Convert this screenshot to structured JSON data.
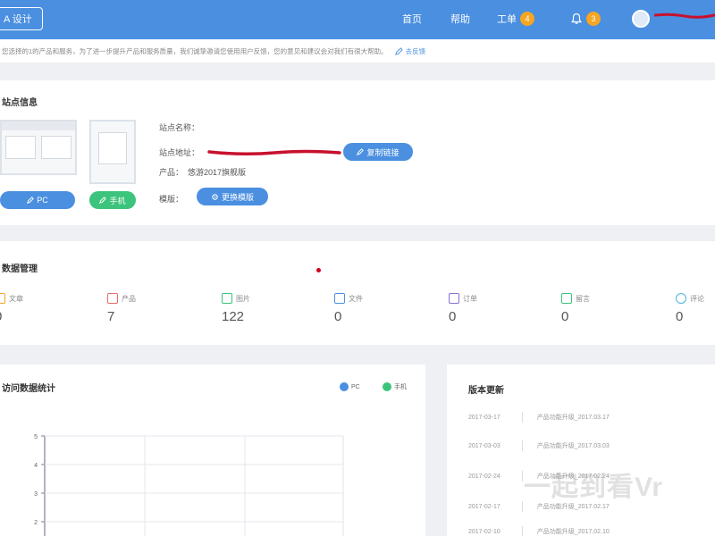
{
  "topbar": {
    "site_btn": "A 设计",
    "nav": [
      {
        "label": "首页"
      },
      {
        "label": "帮助"
      },
      {
        "label": "工单",
        "badge": "4"
      },
      {
        "label": "",
        "badge": "3"
      }
    ],
    "user_name": "",
    "accent": "#4a8fe0"
  },
  "notice": {
    "text": "您选择的1的产品和服务，为了进一步提升产品和服务质量，我们诚挚邀请您使用用户反馈，您的意见和建议会对我们有很大帮助。",
    "link": "去反馈"
  },
  "site": {
    "title": "站点信息",
    "pc_label": "PC",
    "mobile_label": "手机",
    "name_label": "站点名称：",
    "address_label": "站点地址：",
    "address_value": "",
    "copy_btn": "复制链接",
    "product_label": "产品：",
    "product_value": "悠游2017旗舰版",
    "template_label": "模版：",
    "template_btn": "更换模版"
  },
  "data": {
    "title": "数据管理",
    "stats": [
      {
        "label": "文章",
        "value": "0",
        "icon": "article-icon",
        "color": "#f5a623"
      },
      {
        "label": "产品",
        "value": "7",
        "icon": "product-icon",
        "color": "#e86a6a"
      },
      {
        "label": "图片",
        "value": "122",
        "icon": "image-icon",
        "color": "#3cc47c"
      },
      {
        "label": "文件",
        "value": "0",
        "icon": "folder-icon",
        "color": "#4a8fe0"
      },
      {
        "label": "订单",
        "value": "0",
        "icon": "order-icon",
        "color": "#8a6fd8"
      },
      {
        "label": "留言",
        "value": "0",
        "icon": "message-icon",
        "color": "#3cc47c"
      },
      {
        "label": "评论",
        "value": "0",
        "icon": "comment-icon",
        "color": "#4ab6e0"
      }
    ]
  },
  "chart": {
    "title": "访问数据统计",
    "legend": [
      {
        "name": "PC",
        "color": "#4a8fe0"
      },
      {
        "name": "手机",
        "color": "#3cc47c"
      }
    ]
  },
  "chart_data": {
    "type": "line",
    "title": "访问数据统计",
    "y_ticks": [
      2,
      3,
      4,
      5
    ],
    "ylim": [
      0,
      5
    ],
    "grid": true,
    "series": [
      {
        "name": "PC",
        "values": []
      },
      {
        "name": "手机",
        "values": []
      }
    ]
  },
  "updates": {
    "title": "版本更新",
    "items": [
      {
        "date": "2017-03-17",
        "text": "产品功能升级_2017.03.17"
      },
      {
        "date": "2017-03-03",
        "text": "产品功能升级_2017.03.03"
      },
      {
        "date": "2017-02-24",
        "text": "产品功能升级_2017.02.24"
      },
      {
        "date": "2017-02-17",
        "text": "产品功能升级_2017.02.17"
      },
      {
        "date": "2017-02-10",
        "text": "产品功能升级_2017.02.10"
      }
    ],
    "watermark": "一起到看Vr"
  }
}
